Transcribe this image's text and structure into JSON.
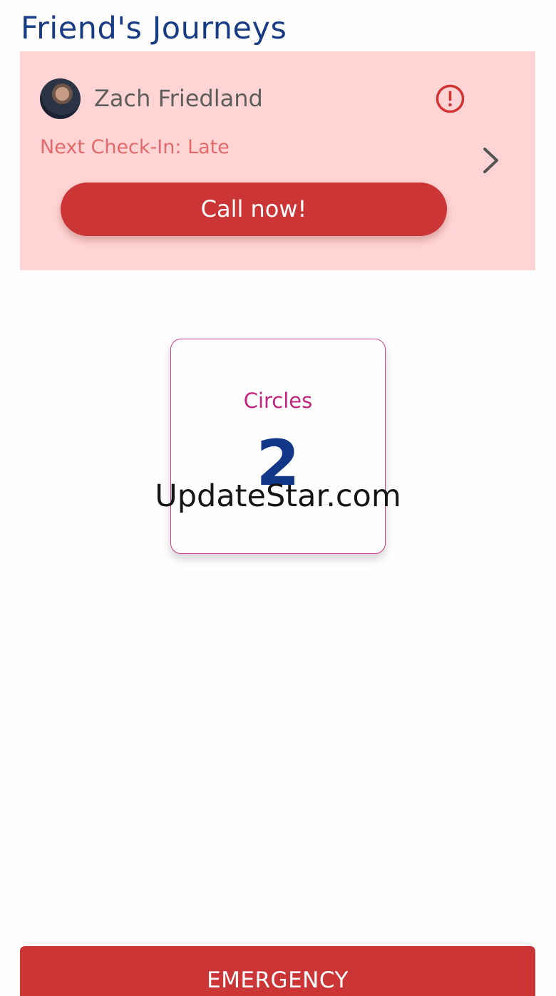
{
  "header": {
    "title": "Friend's Journeys"
  },
  "journey": {
    "friend_name": "Zach Friedland",
    "next_checkin": "Next Check-In: Late",
    "call_label": "Call now!",
    "status_icon": "alert-circle-icon",
    "arrow_icon": "chevron-right-icon"
  },
  "circles": {
    "label": "Circles",
    "count": "2"
  },
  "watermark": {
    "text": "UpdateStar.com"
  },
  "footer": {
    "emergency_label": "EMERGENCY"
  },
  "colors": {
    "title_blue": "#173c85",
    "card_background": "#ffd4d4",
    "accent_red": "#cc3535",
    "circles_magenta": "#c3247f",
    "count_blue": "#123789"
  }
}
